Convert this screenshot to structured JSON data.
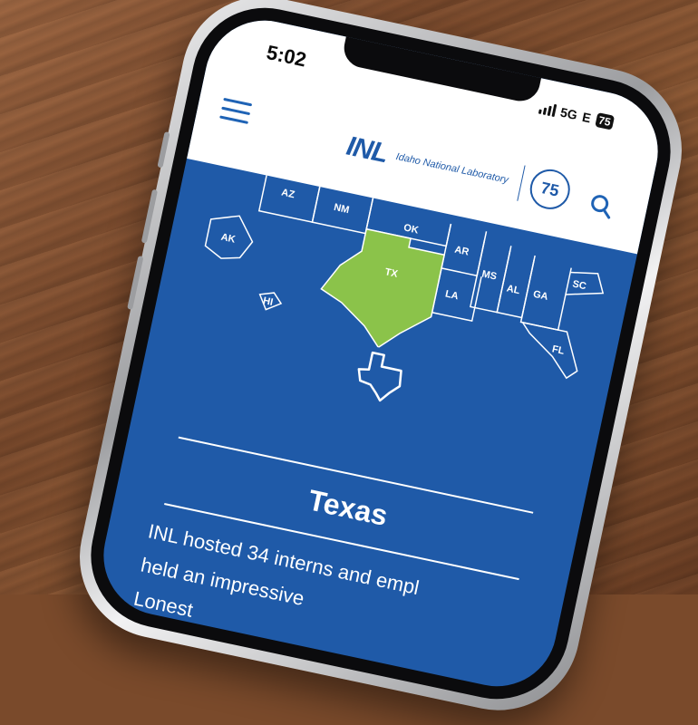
{
  "status_bar": {
    "time": "5:02",
    "network": "5G",
    "network_suffix": "E",
    "battery": "75"
  },
  "header": {
    "logo_text": "INL",
    "lab_name": "Idaho National Laboratory",
    "anniversary": "75"
  },
  "map": {
    "states": [
      "AZ",
      "NM",
      "OK",
      "AR",
      "TX",
      "LA",
      "MS",
      "AL",
      "GA",
      "SC",
      "FL",
      "AK",
      "HI"
    ],
    "highlighted_state": "TX",
    "highlight_color": "#8bc34a"
  },
  "content": {
    "state_title": "Texas",
    "paragraph_lines": [
      "INL hosted 34 interns and empl",
      "held an impressive",
      "Lonest"
    ]
  },
  "colors": {
    "brand_blue": "#1f5aa8",
    "accent": "#8bc34a"
  }
}
